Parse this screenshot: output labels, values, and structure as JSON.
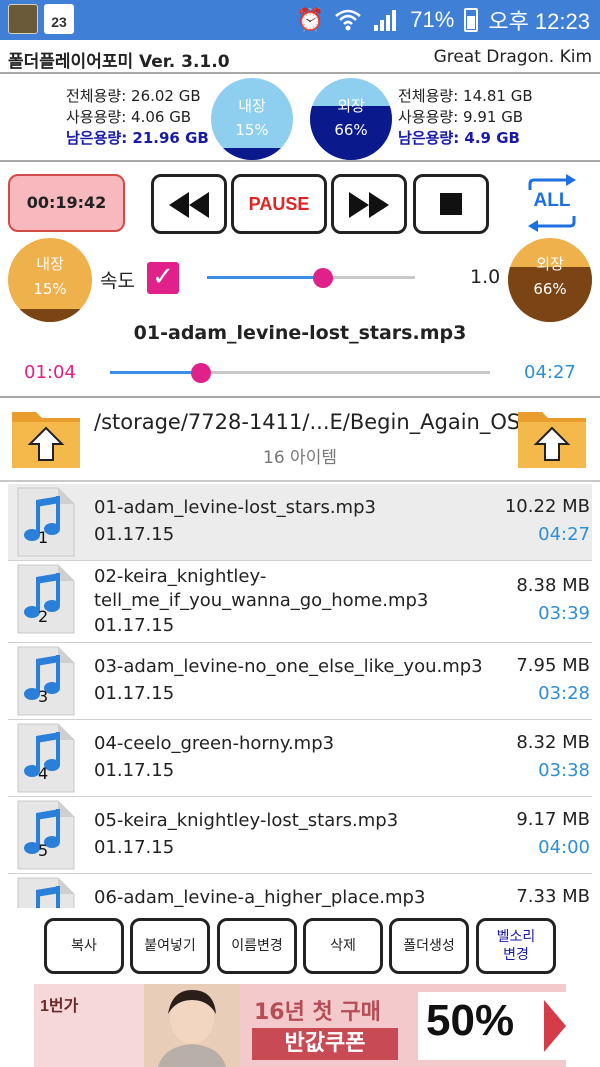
{
  "status": {
    "calendar_day": "23",
    "battery": "71%",
    "time": "오후 12:23"
  },
  "header": {
    "title": "폴더플레이어포미 Ver. 3.1.0",
    "author": "Great Dragon. Kim"
  },
  "storage": {
    "internal": {
      "total_label": "전체용량: 26.02 GB",
      "used_label": "사용용량: 4.06 GB",
      "free_label": "남은용량: 21.96 GB",
      "name": "내장",
      "percent_label": "15%",
      "percent": 15
    },
    "external": {
      "total_label": "전체용량: 14.81 GB",
      "used_label": "사용용량: 9.91 GB",
      "free_label": "남은용량: 4.9 GB",
      "name": "외장",
      "percent_label": "66%",
      "percent": 66
    }
  },
  "controls": {
    "timer": "00:19:42",
    "pause": "PAUSE",
    "repeat": "ALL"
  },
  "speed": {
    "left_gauge": {
      "name": "내장",
      "percent_label": "15%",
      "percent": 15
    },
    "right_gauge": {
      "name": "외장",
      "percent_label": "66%",
      "percent": 66
    },
    "label": "속도",
    "value": "1.0",
    "checked": true,
    "slider_fraction": 0.56
  },
  "now_playing": {
    "title": "01-adam_levine-lost_stars.mp3",
    "elapsed": "01:04",
    "total": "04:27",
    "progress_fraction": 0.24
  },
  "folder": {
    "path": "/storage/7728-1411/...E/Begin_Again_OST",
    "count": "16 아이템"
  },
  "files": [
    {
      "num": "1",
      "name_lines": [
        "01-adam_levine-lost_stars.mp3"
      ],
      "date": "01.17.15",
      "size": "10.22 MB",
      "duration": "04:27"
    },
    {
      "num": "2",
      "name_lines": [
        "02-keira_knightley-",
        "tell_me_if_you_wanna_go_home.mp3"
      ],
      "date": "01.17.15",
      "size": "8.38 MB",
      "duration": "03:39"
    },
    {
      "num": "3",
      "name_lines": [
        "03-adam_levine-no_one_else_like_you.mp3"
      ],
      "date": "01.17.15",
      "size": "7.95 MB",
      "duration": "03:28"
    },
    {
      "num": "4",
      "name_lines": [
        "04-ceelo_green-horny.mp3"
      ],
      "date": "01.17.15",
      "size": "8.32 MB",
      "duration": "03:38"
    },
    {
      "num": "5",
      "name_lines": [
        "05-keira_knightley-lost_stars.mp3"
      ],
      "date": "01.17.15",
      "size": "9.17 MB",
      "duration": "04:00"
    },
    {
      "num": "6",
      "name_lines": [
        "06-adam_levine-a_higher_place.mp3"
      ],
      "date": "",
      "size": "7.33 MB",
      "duration": ""
    }
  ],
  "actions": {
    "copy": "복사",
    "paste": "붙여넣기",
    "rename": "이름변경",
    "delete": "삭제",
    "new_folder": "폴더생성",
    "ringtone_line1": "벨소리",
    "ringtone_line2": "변경"
  },
  "ad": {
    "logo": "1번가",
    "line1": "16년 첫 구매",
    "line2": "반값쿠폰",
    "percent": "50%"
  },
  "colors": {
    "status_bar": "#3f7fd6",
    "accent_pink": "#e0218a",
    "accent_blue": "#2f8fd6",
    "internal_gauge": "#8ecff0",
    "external_gauge_fill": "#0a1a8c",
    "orange_gauge": "#efb14b",
    "brown_gauge_fill": "#7a4414"
  }
}
